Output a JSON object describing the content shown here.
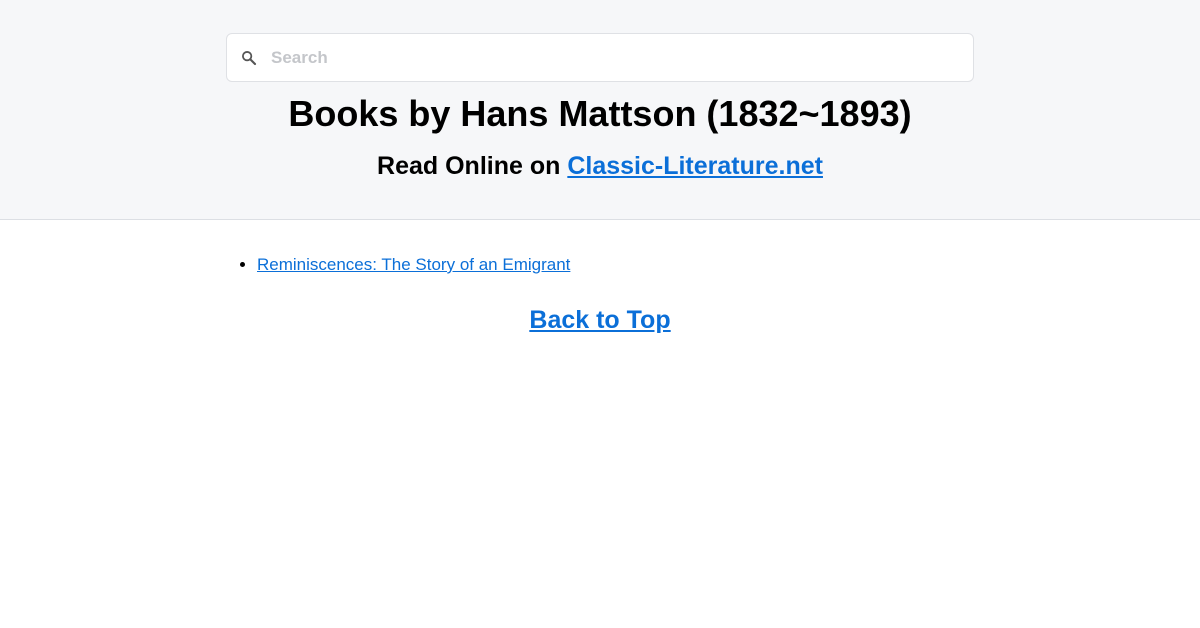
{
  "search": {
    "placeholder": "Search",
    "value": "",
    "icon": "search-icon"
  },
  "header": {
    "title": "Books by Hans Mattson (1832~1893)",
    "subtitle_prefix": "Read Online on ",
    "subtitle_link": "Classic-Literature.net"
  },
  "books": [
    {
      "title": "Reminiscences: The Story of an Emigrant"
    }
  ],
  "footer": {
    "back_to_top": "Back to Top"
  },
  "colors": {
    "link": "#0b6fd8",
    "header_bg": "#f6f7f9"
  }
}
